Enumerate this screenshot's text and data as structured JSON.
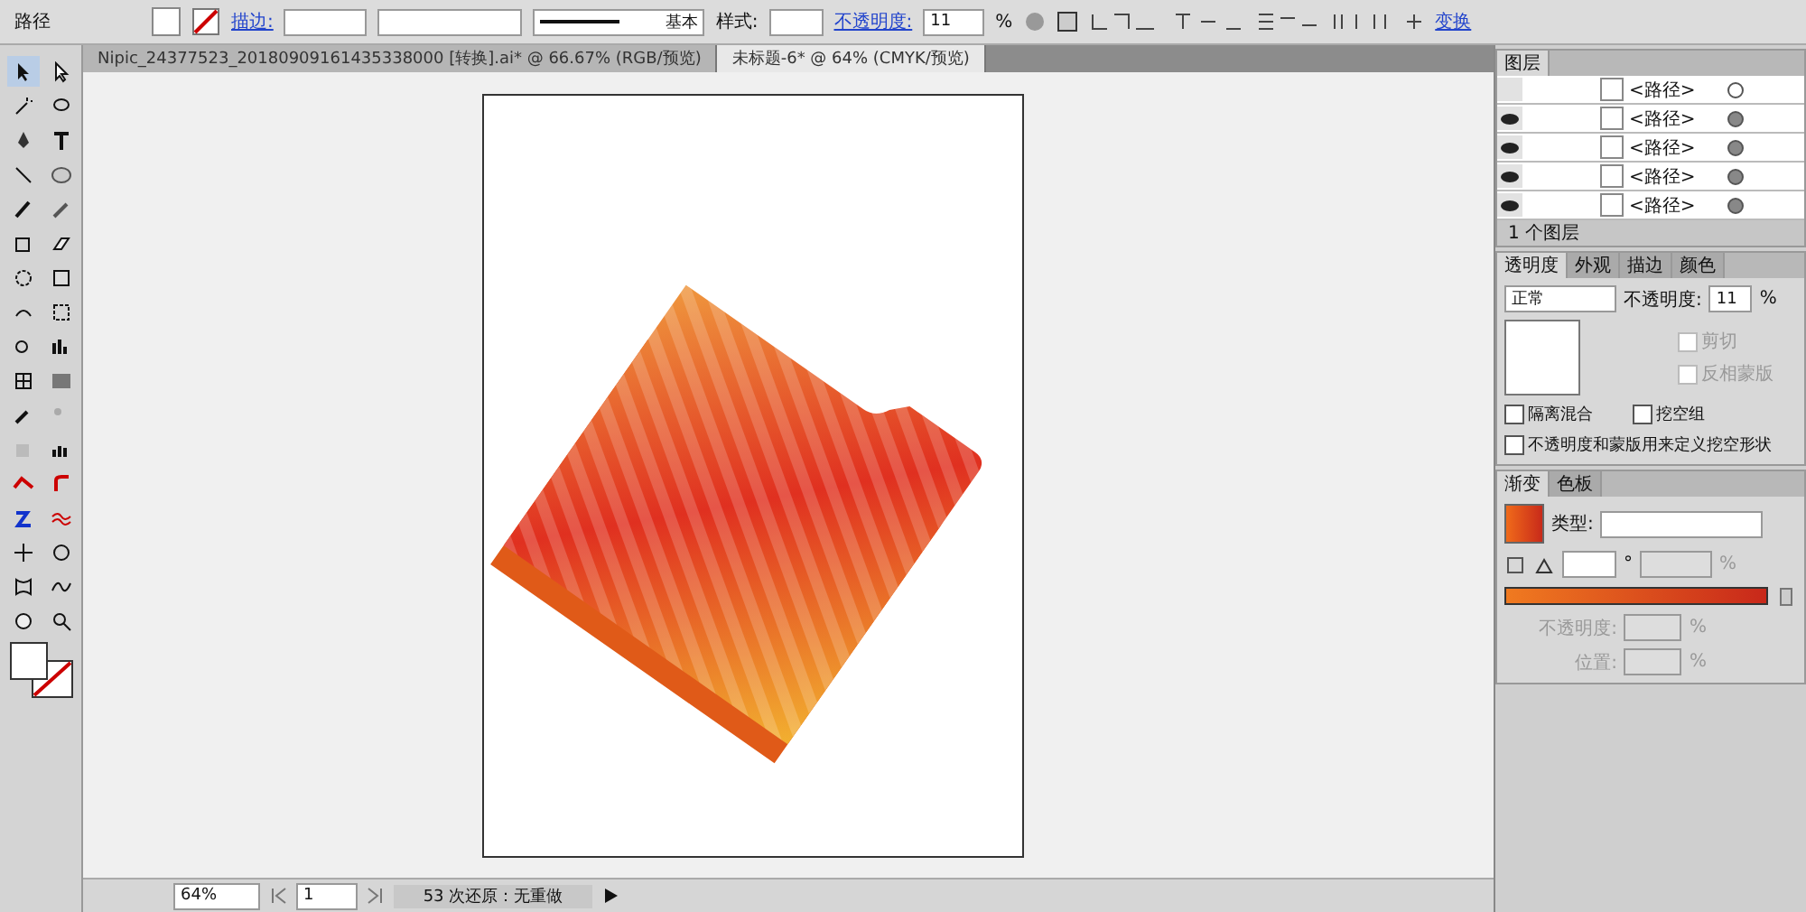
{
  "control_bar": {
    "object_type": "路径",
    "stroke_label": "描边:",
    "stroke_profile": "基本",
    "style_label": "样式:",
    "opacity_label": "不透明度:",
    "opacity_value": "11",
    "opacity_unit": "%",
    "transform_link": "变换"
  },
  "document_tabs": [
    {
      "title": "Nipic_24377523_20180909161435338000 [转换].ai* @ 66.67% (RGB/预览)",
      "selected": false
    },
    {
      "title": "未标题-6* @ 64% (CMYK/预览)",
      "selected": true
    }
  ],
  "layers_panel": {
    "title": "图层",
    "rows": [
      {
        "name": "<路径>",
        "visible": false
      },
      {
        "name": "<路径>",
        "visible": true
      },
      {
        "name": "<路径>",
        "visible": true
      },
      {
        "name": "<路径>",
        "visible": true
      },
      {
        "name": "<路径>",
        "visible": true
      }
    ],
    "footer": "1 个图层"
  },
  "transparency_panel": {
    "tabs": [
      {
        "label": "透明度",
        "selected": true
      },
      {
        "label": "外观",
        "selected": false
      },
      {
        "label": "描边",
        "selected": false
      },
      {
        "label": "颜色",
        "selected": false
      }
    ],
    "blend_mode": "正常",
    "opacity_label": "不透明度:",
    "opacity_value": "11",
    "opacity_unit": "%",
    "mask_options": [
      {
        "label": "剪切",
        "checked": false,
        "disabled": true
      },
      {
        "label": "反相蒙版",
        "checked": false,
        "disabled": true
      }
    ],
    "options": [
      {
        "label": "隔离混合",
        "checked": false
      },
      {
        "label": "挖空组",
        "checked": false
      },
      {
        "label": "不透明度和蒙版用来定义挖空形状",
        "checked": false
      }
    ]
  },
  "gradient_panel": {
    "tabs": [
      {
        "label": "渐变",
        "selected": true
      },
      {
        "label": "色板",
        "selected": false
      }
    ],
    "type_label": "类型:",
    "angle_unit": "°",
    "aspect_unit": "%",
    "stop_fields": [
      {
        "label": "不透明度:",
        "unit": "%"
      },
      {
        "label": "位置:",
        "unit": "%"
      }
    ]
  },
  "status_bar": {
    "zoom": "64%",
    "artboard": "1",
    "status": "53 次还原：无重做"
  }
}
